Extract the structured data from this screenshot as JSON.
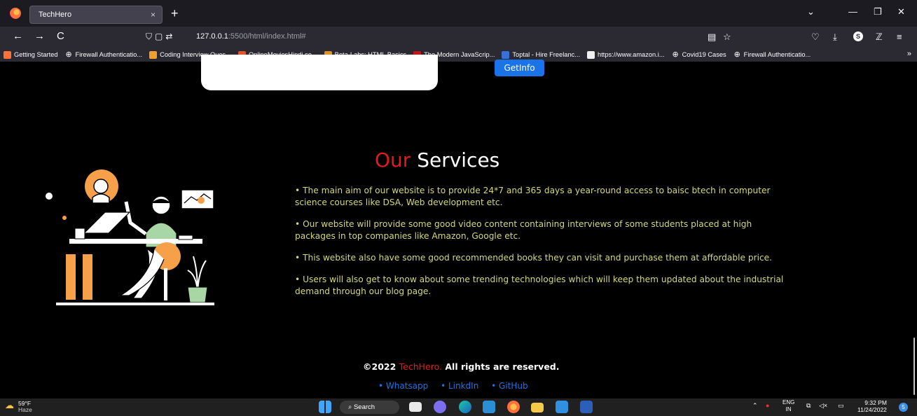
{
  "browser": {
    "tab_title": "TechHero",
    "tab_close": "×",
    "new_tab": "+",
    "url_host": "127.0.0.1",
    "url_rest": ":5500/html/index.html#",
    "nav": {
      "back": "←",
      "forward": "→",
      "reload": "C"
    },
    "window": {
      "list": "⌄",
      "minimize": "—",
      "restore": "❐",
      "close": "✕"
    },
    "right_icons": {
      "reader": "▤",
      "star": "☆",
      "pocket": "♡",
      "download": "⤓",
      "account": "S",
      "extensions": "ℤ",
      "menu": "≡"
    },
    "bookmarks": [
      {
        "label": "Getting Started",
        "icon": "firefox-icon",
        "color": "#ff7139"
      },
      {
        "label": "Firewall Authenticatio...",
        "icon": "globe-icon",
        "color": "#2b2a33"
      },
      {
        "label": "Coding Interview Ques...",
        "icon": "cc-icon",
        "color": "#f0a030"
      },
      {
        "label": "OnlineMoviesHindi.co...",
        "icon": "popcorn-icon",
        "color": "#e0552a"
      },
      {
        "label": "Beta-Labs: HTML Basics",
        "icon": "beta-icon",
        "color": "#e09020"
      },
      {
        "label": "The Modern JavaScrip...",
        "icon": "x-icon",
        "color": "#c01818"
      },
      {
        "label": "Toptal - Hire Freelanc...",
        "icon": "toptal-icon",
        "color": "#3a6fd8"
      },
      {
        "label": "https://www.amazon.i...",
        "icon": "amazon-icon",
        "color": "#f0f0f0"
      },
      {
        "label": "Covid19 Cases",
        "icon": "globe-icon",
        "color": "#2b2a33"
      },
      {
        "label": "Firewall Authenticatio...",
        "icon": "globe-icon",
        "color": "#2b2a33"
      }
    ],
    "bookmarks_more": "»"
  },
  "page": {
    "getinfo_label": "GetInfo",
    "title_highlight": "Our",
    "title_rest": " Services",
    "services": [
      "• The main aim of our website is to provide 24*7 and 365 days a year-round access to baisc btech in computer science courses like DSA, Web development etc.",
      "• Our website will provide some good video content containing interviews of some students placed at high packages in top companies like Amazon, Google etc.",
      "• This website also have some good recommended books they can visit and purchase them at affordable price.",
      "• Users will also get to know about some trending technologies which will keep them updated about the industrial demand through our blog page."
    ],
    "footer_prefix": "©2022 ",
    "footer_brand": "TechHero.",
    "footer_suffix": " All rights are reserved.",
    "links": [
      "• Whatsapp",
      "• LinkdIn",
      "• GitHub"
    ]
  },
  "taskbar": {
    "temp": "59°F",
    "condition": "Haze",
    "search_label": "Search",
    "lang": "ENG",
    "lang_sub": "IN",
    "time": "9:32 PM",
    "date": "11/24/2022",
    "notif_count": "5"
  }
}
